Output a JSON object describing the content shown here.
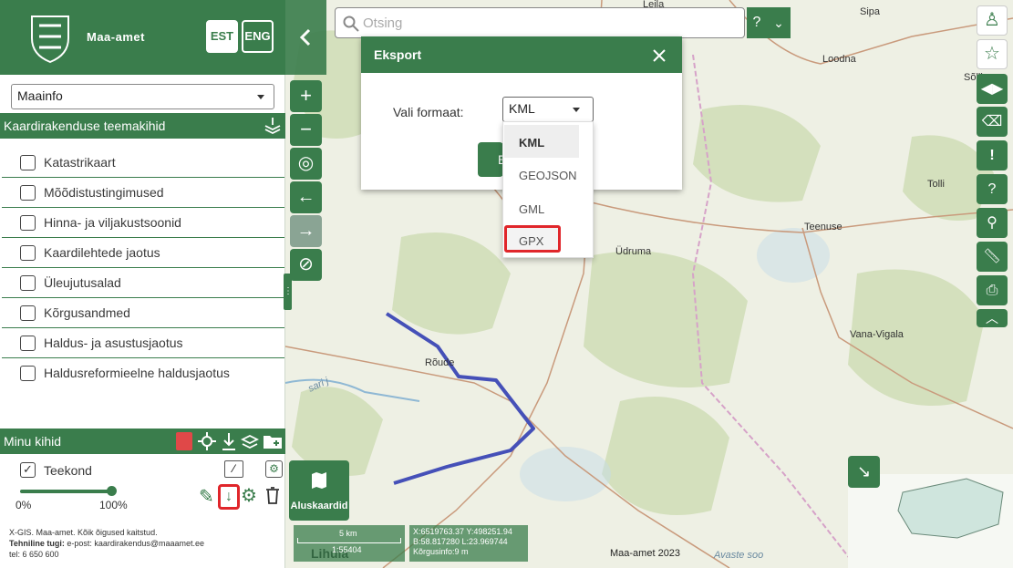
{
  "app": {
    "name": "Maa-amet",
    "lang_est": "EST",
    "lang_eng": "ENG"
  },
  "theme_select": {
    "value": "Maainfo"
  },
  "theme_layers": {
    "title": "Kaardirakenduse teemakihid",
    "items": [
      {
        "label": "Katastrikaart"
      },
      {
        "label": "Mõõdistustingimused"
      },
      {
        "label": "Hinna- ja viljakustsoonid"
      },
      {
        "label": "Kaardilehtede jaotus"
      },
      {
        "label": "Üleujutusalad"
      },
      {
        "label": "Kõrgusandmed"
      },
      {
        "label": "Haldus- ja asustusjaotus"
      },
      {
        "label": "Haldusreformieelne haldusjaotus"
      }
    ]
  },
  "my_layers": {
    "title": "Minu kihid",
    "track": {
      "label": "Teekond",
      "checked": true,
      "opacity_min": "0%",
      "opacity_max": "100%",
      "opacity": 0.95
    }
  },
  "footer": {
    "line1": "X-GIS. Maa-amet. Kõik õigused kaitstud.",
    "line2_bold": "Tehniline tugi:",
    "line2": " e-post: kaardirakendus@maaamet.ee",
    "line3": "tel: 6 650 600"
  },
  "search": {
    "placeholder": "Otsing",
    "help": "?"
  },
  "export_dialog": {
    "title": "Eksport",
    "format_label": "Vali formaat:",
    "selected": "KML",
    "button_partial": "E",
    "options": [
      "KML",
      "GEOJSON",
      "GML",
      "GPX"
    ]
  },
  "basemap": {
    "label": "Aluskaardid"
  },
  "status": {
    "scale_label": "5 km",
    "scale": "1:55404",
    "coords": "X:6519763.37 Y:498251.94",
    "latlon": "B:58.817280 L:23.969744",
    "elevation": "Kõrgusinfo:9 m"
  },
  "copyright": "Maa-amet 2023",
  "places": [
    "Leila",
    "Sipa",
    "Loodna",
    "Sõlli",
    "Tolli",
    "Teenuse",
    "Üdruma",
    "Vana-Vigala",
    "Rõude",
    "Lihula",
    "Avaste soo",
    "sari j"
  ],
  "colors": {
    "primary": "#3a7d4c",
    "route": "#4550b8",
    "highlight": "#e0262b"
  }
}
